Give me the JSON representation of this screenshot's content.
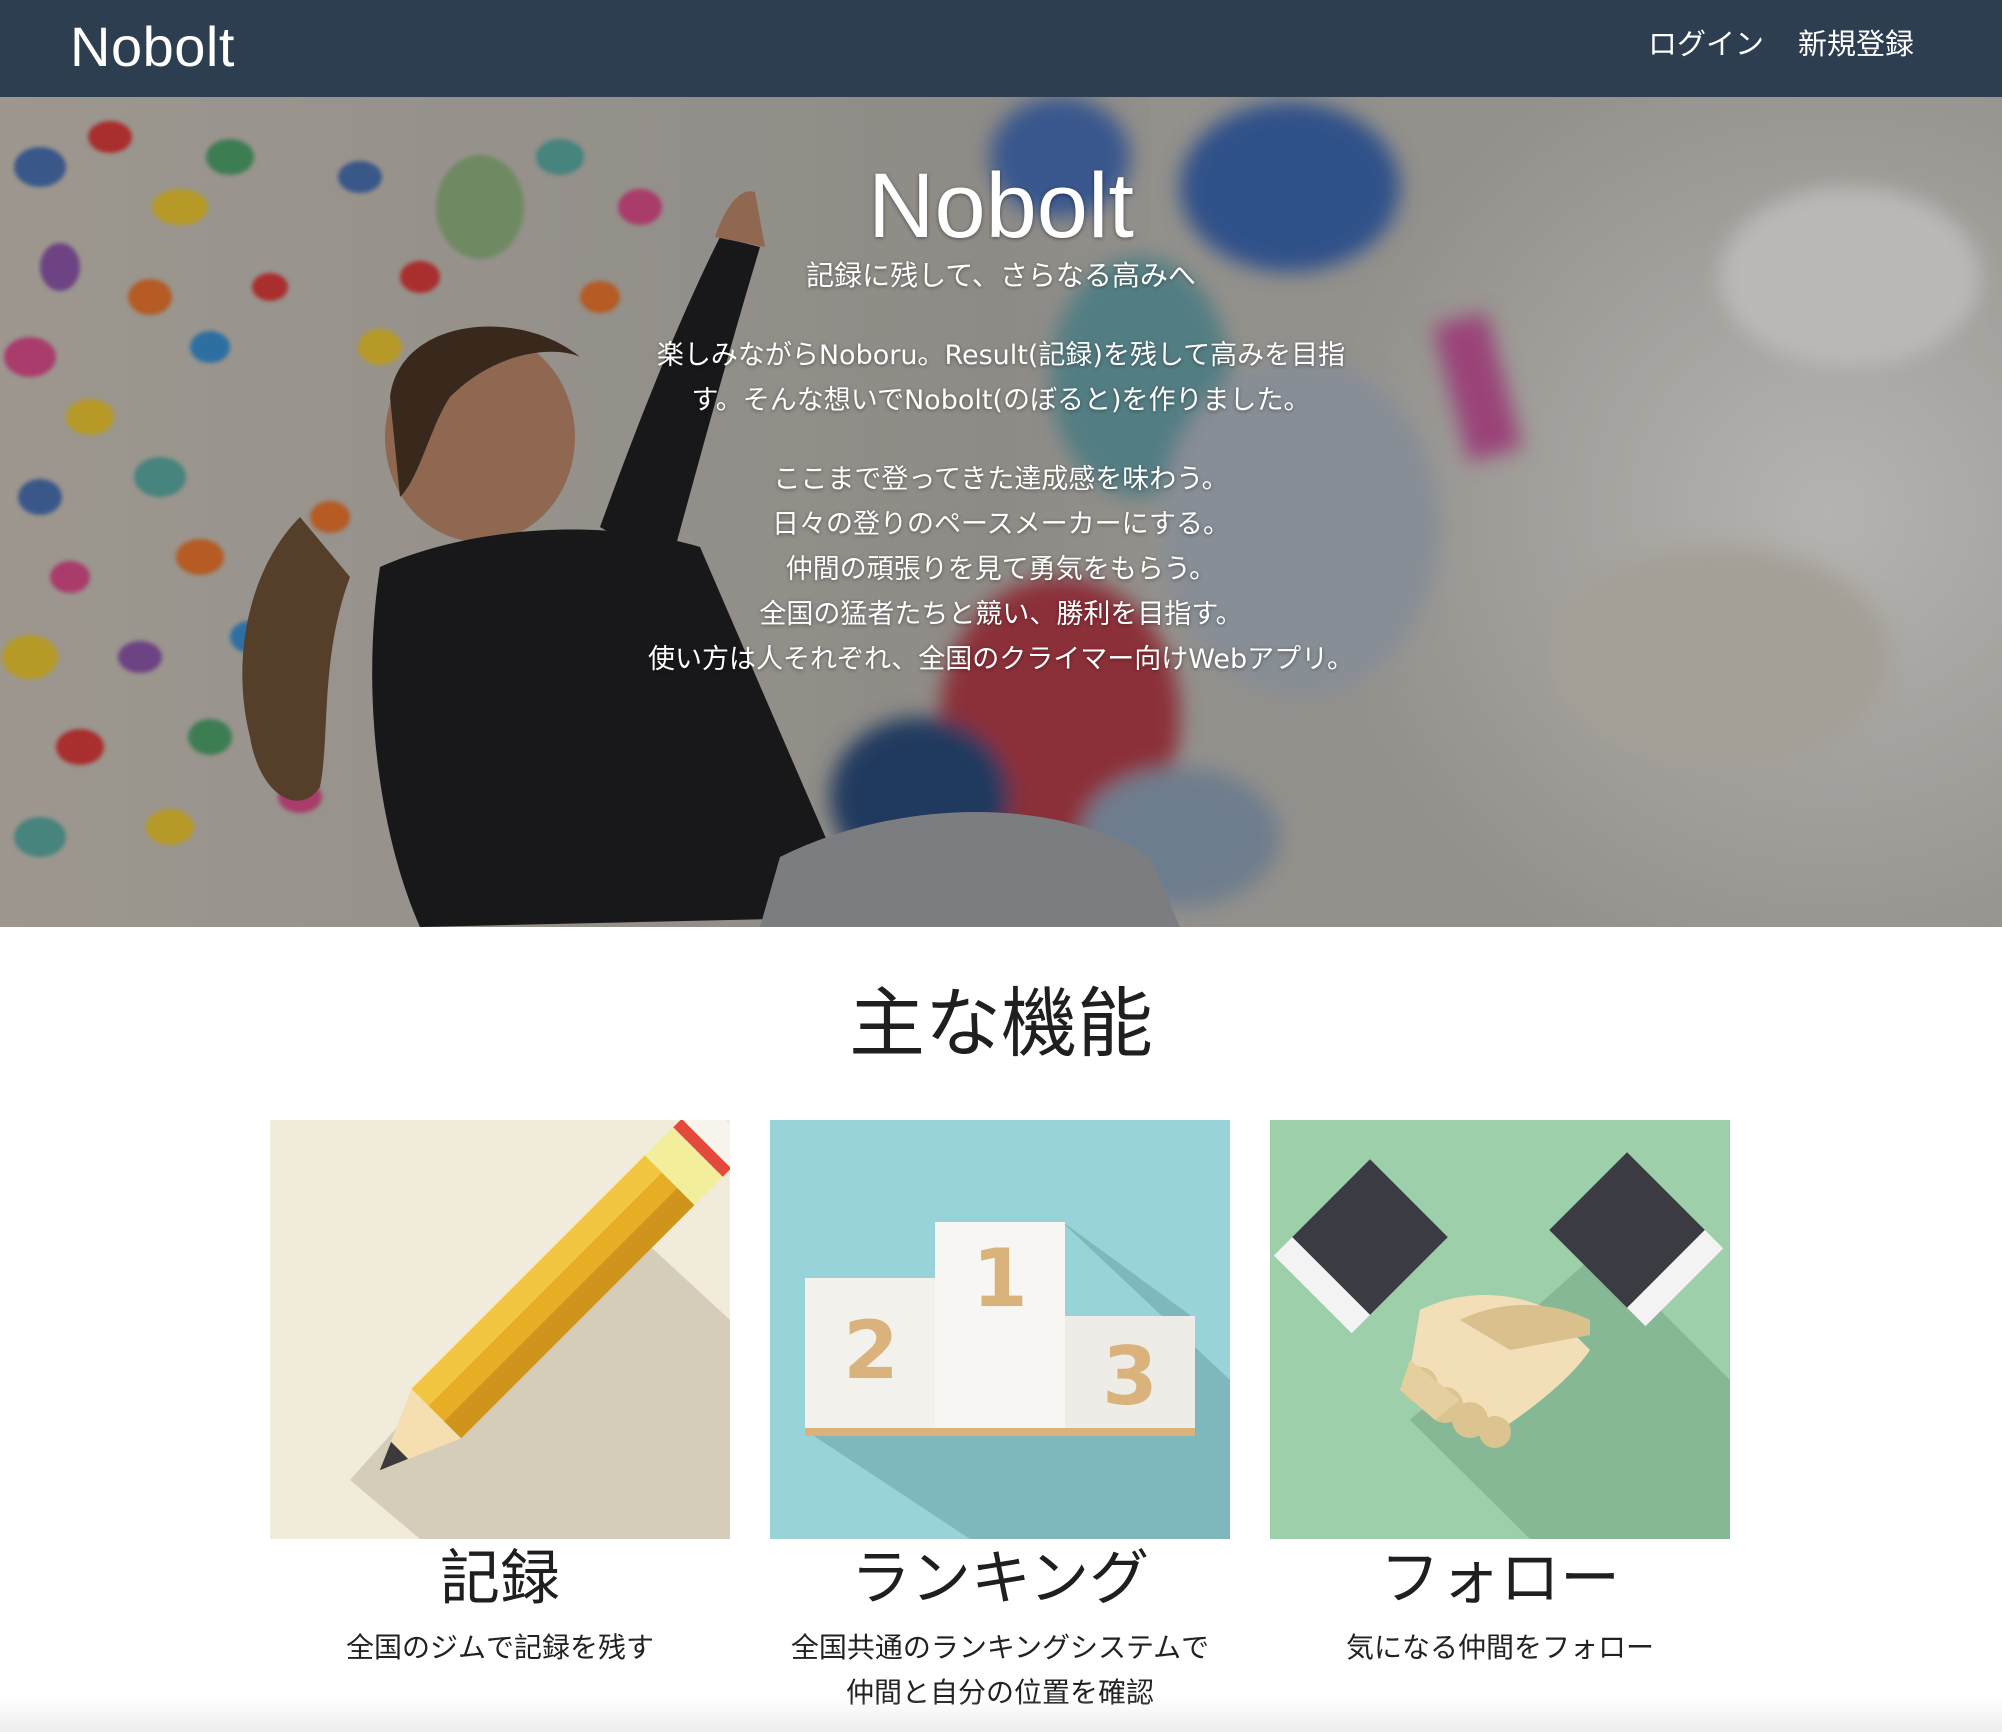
{
  "navbar": {
    "brand": "Nobolt",
    "login_label": "ログイン",
    "signup_label": "新規登録"
  },
  "hero": {
    "title": "Nobolt",
    "subtitle": "記録に残して、さらなる高みへ",
    "paragraph1": [
      "楽しみながらNoboru。Result(記録)を残して高みを目指",
      "す。そんな想いでNobolt(のぼると)を作りました。"
    ],
    "paragraph2": [
      "ここまで登ってきた達成感を味わう。",
      "日々の登りのペースメーカーにする。",
      "仲間の頑張りを見て勇気をもらう。",
      "全国の猛者たちと競い、勝利を目指す。",
      "使い方は人それぞれ、全国のクライマー向けWebアプリ。"
    ],
    "image": "climber-bouldering-wall"
  },
  "features": {
    "heading": "主な機能",
    "items": [
      {
        "title": "記録",
        "description": [
          "全国のジムで記録を残す"
        ],
        "icon": "pencil-icon",
        "bg_color": "#f1ebdb"
      },
      {
        "title": "ランキング",
        "description": [
          "全国共通のランキングシステムで",
          "仲間と自分の位置を確認"
        ],
        "icon": "podium-icon",
        "bg_color": "#98d3d9",
        "podium_labels": [
          "2",
          "1",
          "3"
        ]
      },
      {
        "title": "フォロー",
        "description": [
          "気になる仲間をフォロー"
        ],
        "icon": "handshake-icon",
        "bg_color": "#9ccfaa"
      }
    ]
  },
  "colors": {
    "navbar_bg": "#2d3e50",
    "text_primary": "#1f1f1f",
    "pencil_yellow": "#e7ad24",
    "podium_number": "#d9b27c"
  }
}
